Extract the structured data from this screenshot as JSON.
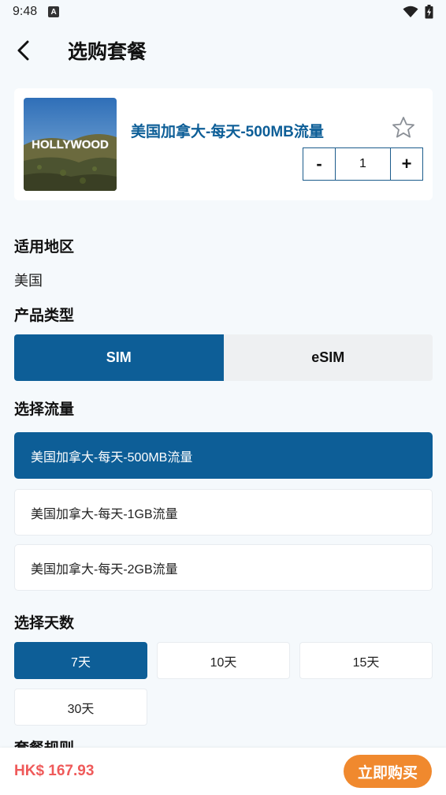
{
  "status_bar": {
    "time": "9:48",
    "notification_icon": "a-icon",
    "wifi_icon": "wifi-icon",
    "battery_icon": "battery-icon"
  },
  "header": {
    "back_icon": "chevron-left-icon",
    "title": "选购套餐"
  },
  "product": {
    "image_alt": "HOLLYWOOD",
    "name": "美国加拿大-每天-500MB流量",
    "favorite_icon": "star-outline-icon",
    "quantity": {
      "minus": "-",
      "value": "1",
      "plus": "+"
    }
  },
  "region": {
    "label": "适用地区",
    "value": "美国"
  },
  "product_type": {
    "label": "产品类型",
    "options": [
      {
        "label": "SIM",
        "selected": true
      },
      {
        "label": "eSIM",
        "selected": false
      }
    ]
  },
  "data_plan": {
    "label": "选择流量",
    "options": [
      {
        "label": "美国加拿大-每天-500MB流量",
        "selected": true
      },
      {
        "label": "美国加拿大-每天-1GB流量",
        "selected": false
      },
      {
        "label": "美国加拿大-每天-2GB流量",
        "selected": false
      }
    ]
  },
  "days": {
    "label": "选择天数",
    "options": [
      {
        "label": "7天",
        "selected": true
      },
      {
        "label": "10天",
        "selected": false
      },
      {
        "label": "15天",
        "selected": false
      },
      {
        "label": "30天",
        "selected": false
      }
    ]
  },
  "rules": {
    "label": "套餐规则"
  },
  "footer": {
    "price": "HK$ 167.93",
    "buy_label": "立即购买"
  },
  "colors": {
    "primary": "#0d5e97",
    "price": "#ef5a5a",
    "buy": "#f0892e",
    "background": "#f5f9fc"
  }
}
